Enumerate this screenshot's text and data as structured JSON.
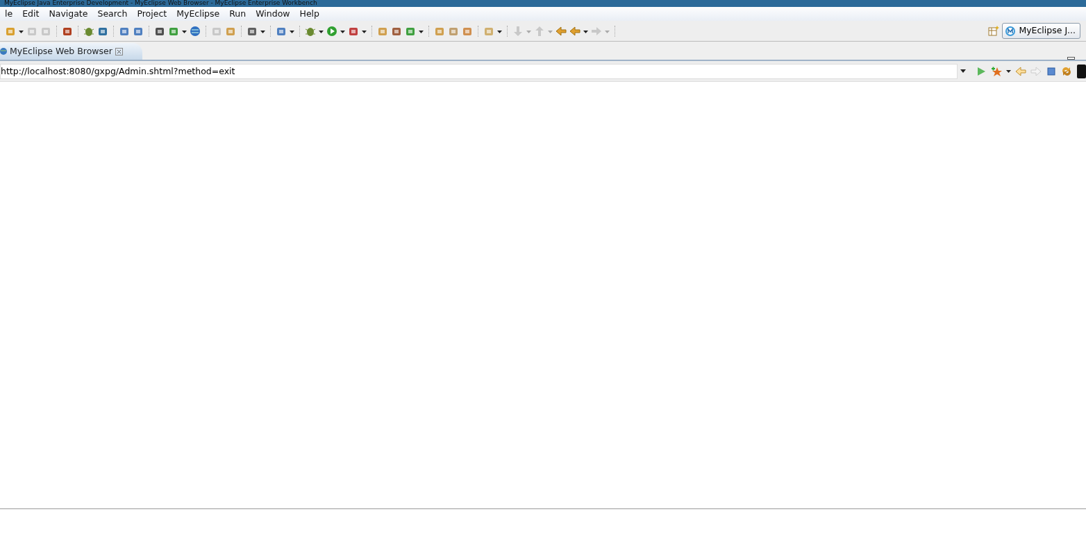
{
  "window": {
    "title": "MyEclipse Java Enterprise Development - MyEclipse Web Browser - MyEclipse Enterprise Workbench"
  },
  "menu": [
    "le",
    "Edit",
    "Navigate",
    "Search",
    "Project",
    "MyEclipse",
    "Run",
    "Window",
    "Help"
  ],
  "toolbar": {
    "groups": [
      {
        "items": [
          {
            "dropdown": true,
            "disabled": false
          },
          {
            "dropdown": false,
            "disabled": true
          },
          {
            "dropdown": false,
            "disabled": true
          }
        ]
      },
      {
        "items": [
          {
            "dropdown": false,
            "disabled": false
          }
        ]
      },
      {
        "items": [
          {
            "dropdown": false,
            "disabled": false
          },
          {
            "dropdown": false,
            "disabled": false
          }
        ]
      },
      {
        "items": [
          {
            "dropdown": false,
            "disabled": false
          },
          {
            "dropdown": false,
            "disabled": false
          }
        ]
      },
      {
        "items": [
          {
            "dropdown": false,
            "disabled": false
          },
          {
            "dropdown": true,
            "disabled": false
          },
          {
            "dropdown": false,
            "disabled": false
          }
        ]
      },
      {
        "items": [
          {
            "dropdown": false,
            "disabled": true
          },
          {
            "dropdown": false,
            "disabled": false
          }
        ]
      },
      {
        "items": [
          {
            "dropdown": true,
            "disabled": false
          }
        ]
      },
      {
        "items": [
          {
            "dropdown": true,
            "disabled": false
          }
        ]
      },
      {
        "items": [
          {
            "dropdown": true,
            "disabled": false
          },
          {
            "dropdown": true,
            "disabled": false
          },
          {
            "dropdown": true,
            "disabled": false
          }
        ]
      },
      {
        "items": [
          {
            "dropdown": false,
            "disabled": false
          },
          {
            "dropdown": false,
            "disabled": false
          },
          {
            "dropdown": true,
            "disabled": false
          }
        ]
      },
      {
        "items": [
          {
            "dropdown": false,
            "disabled": false
          },
          {
            "dropdown": false,
            "disabled": false
          },
          {
            "dropdown": false,
            "disabled": false
          }
        ]
      },
      {
        "items": [
          {
            "dropdown": true,
            "disabled": false
          }
        ]
      },
      {
        "items": [
          {
            "dropdown": true,
            "disabled": true
          },
          {
            "dropdown": true,
            "disabled": true
          },
          {
            "dropdown": false,
            "disabled": false
          },
          {
            "dropdown": true,
            "disabled": false
          },
          {
            "dropdown": true,
            "disabled": true
          }
        ]
      }
    ]
  },
  "perspective": {
    "label": "MyEclipse J..."
  },
  "tabs": [
    {
      "label": "MyEclipse Web Browser",
      "selected": true
    }
  ],
  "browser": {
    "url": "http://localhost:8080/gxpg/Admin.shtml?method=exit",
    "forward_disabled": true
  }
}
